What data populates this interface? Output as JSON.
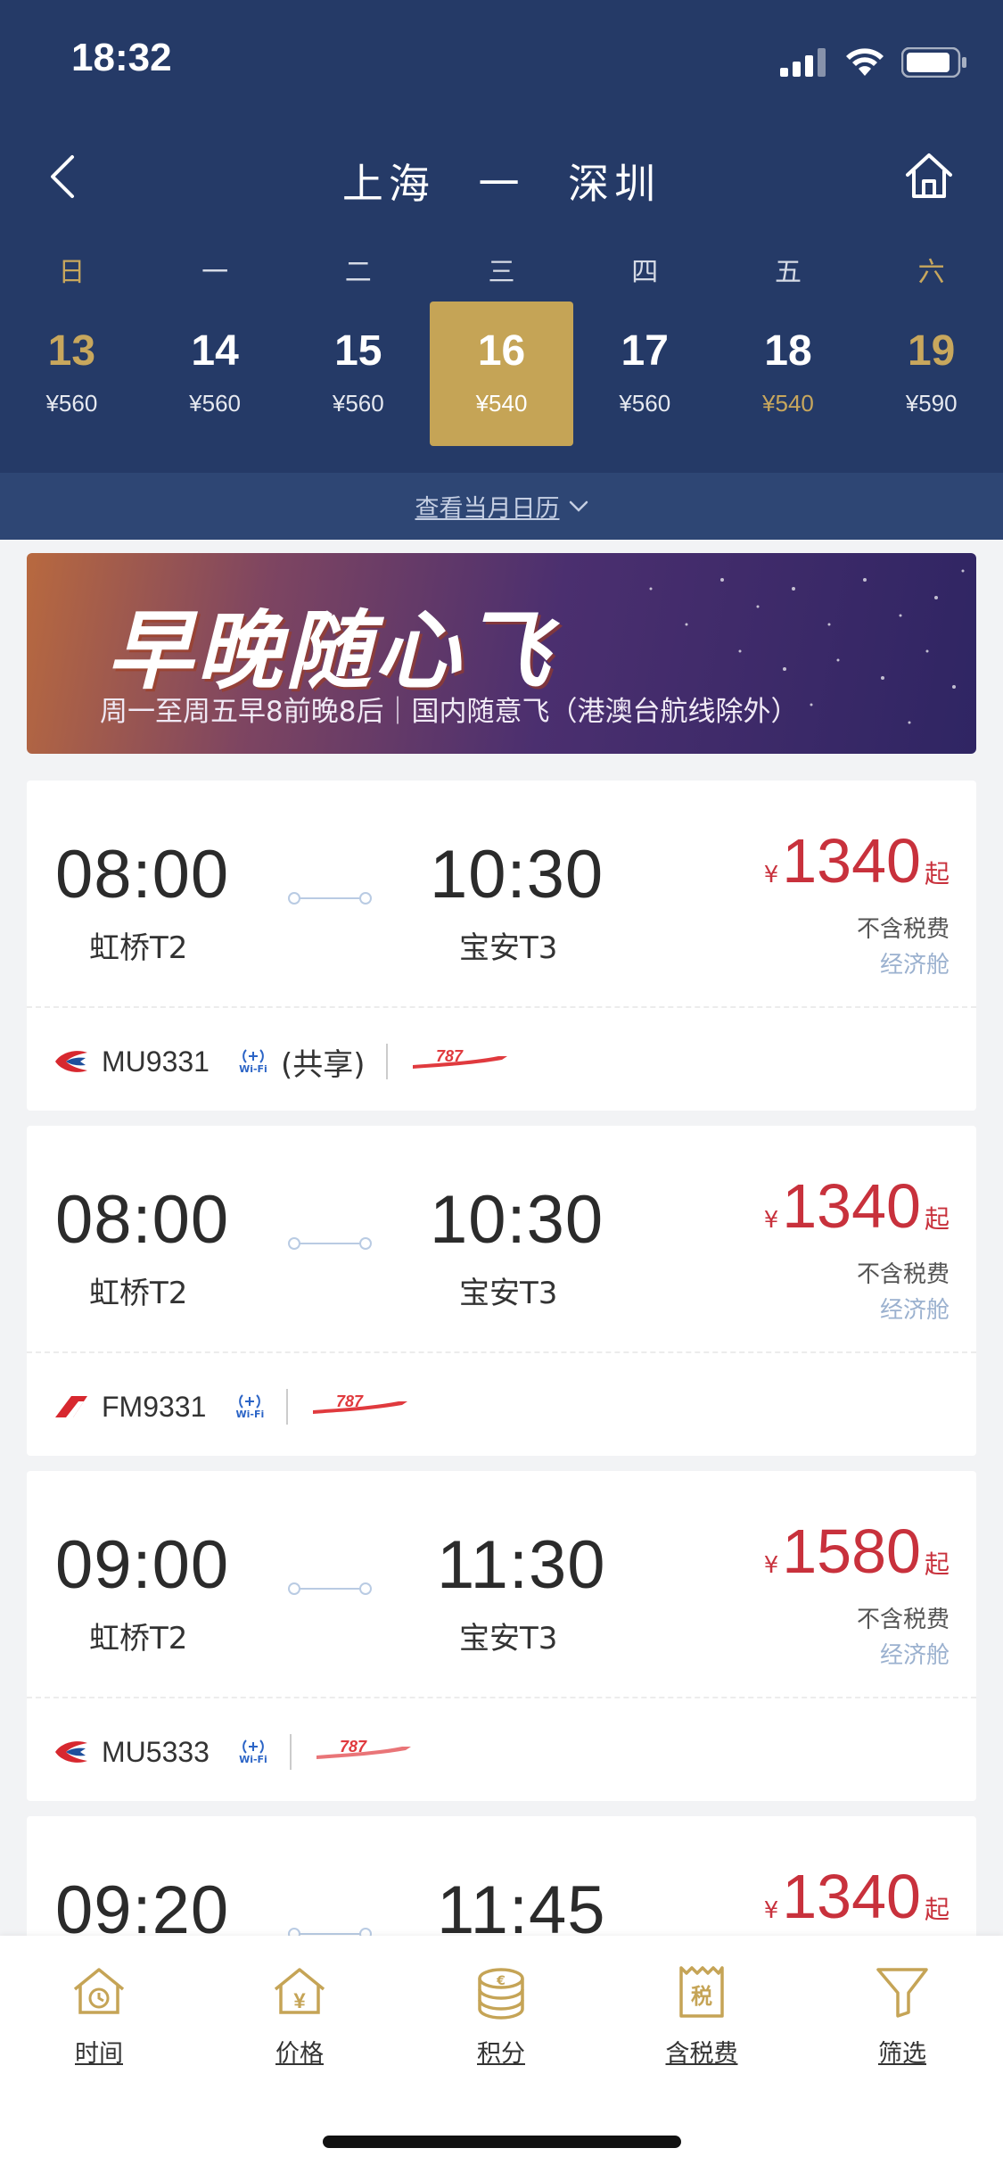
{
  "status_bar": {
    "time": "18:32"
  },
  "header": {
    "origin": "上海",
    "dash": "一",
    "destination": "深圳"
  },
  "weekdays": [
    "日",
    "一",
    "二",
    "三",
    "四",
    "五",
    "六"
  ],
  "dates": [
    {
      "day": "13",
      "price": "¥560"
    },
    {
      "day": "14",
      "price": "¥560"
    },
    {
      "day": "15",
      "price": "¥560"
    },
    {
      "day": "16",
      "price": "¥540"
    },
    {
      "day": "17",
      "price": "¥560"
    },
    {
      "day": "18",
      "price": "¥540"
    },
    {
      "day": "19",
      "price": "¥590"
    }
  ],
  "calendar_link": "查看当月日历",
  "banner": {
    "title": "早晚随心飞",
    "subtitle": "周一至周五早8前晚8后｜国内随意飞（港澳台航线除外）"
  },
  "flights": [
    {
      "dep_time": "08:00",
      "dep_airport": "虹桥T2",
      "arr_time": "10:30",
      "arr_airport": "宝安T3",
      "yen": "¥",
      "price": "1340",
      "suffix": "起",
      "tax_note": "不含税费",
      "cabin": "经济舱",
      "flight_no": "MU9331",
      "wifi": "Wi-Fi",
      "share": "(共享)",
      "aircraft": "787"
    },
    {
      "dep_time": "08:00",
      "dep_airport": "虹桥T2",
      "arr_time": "10:30",
      "arr_airport": "宝安T3",
      "yen": "¥",
      "price": "1340",
      "suffix": "起",
      "tax_note": "不含税费",
      "cabin": "经济舱",
      "flight_no": "FM9331",
      "wifi": "Wi-Fi",
      "share": "",
      "aircraft": "787"
    },
    {
      "dep_time": "09:00",
      "dep_airport": "虹桥T2",
      "arr_time": "11:30",
      "arr_airport": "宝安T3",
      "yen": "¥",
      "price": "1580",
      "suffix": "起",
      "tax_note": "不含税费",
      "cabin": "经济舱",
      "flight_no": "MU5333",
      "wifi": "Wi-Fi",
      "share": "",
      "aircraft": "787"
    },
    {
      "dep_time": "09:20",
      "dep_airport": "",
      "arr_time": "11:45",
      "arr_airport": "",
      "yen": "¥",
      "price": "1340",
      "suffix": "起",
      "tax_note": "",
      "cabin": "",
      "flight_no": "",
      "wifi": "",
      "share": "",
      "aircraft": ""
    }
  ],
  "tabs": [
    "时间",
    "价格",
    "积分",
    "含税费",
    "筛选"
  ],
  "tab_icon_badges": {
    "price": "¥",
    "tax": "税",
    "points": "€"
  },
  "colors": {
    "header": "#253a67",
    "accent_gold": "#c5a456",
    "price_red": "#c8313c",
    "cabin_blue": "#9bb1cf",
    "airline_red": "#d7282f",
    "airline_blue": "#1e4f9c"
  }
}
